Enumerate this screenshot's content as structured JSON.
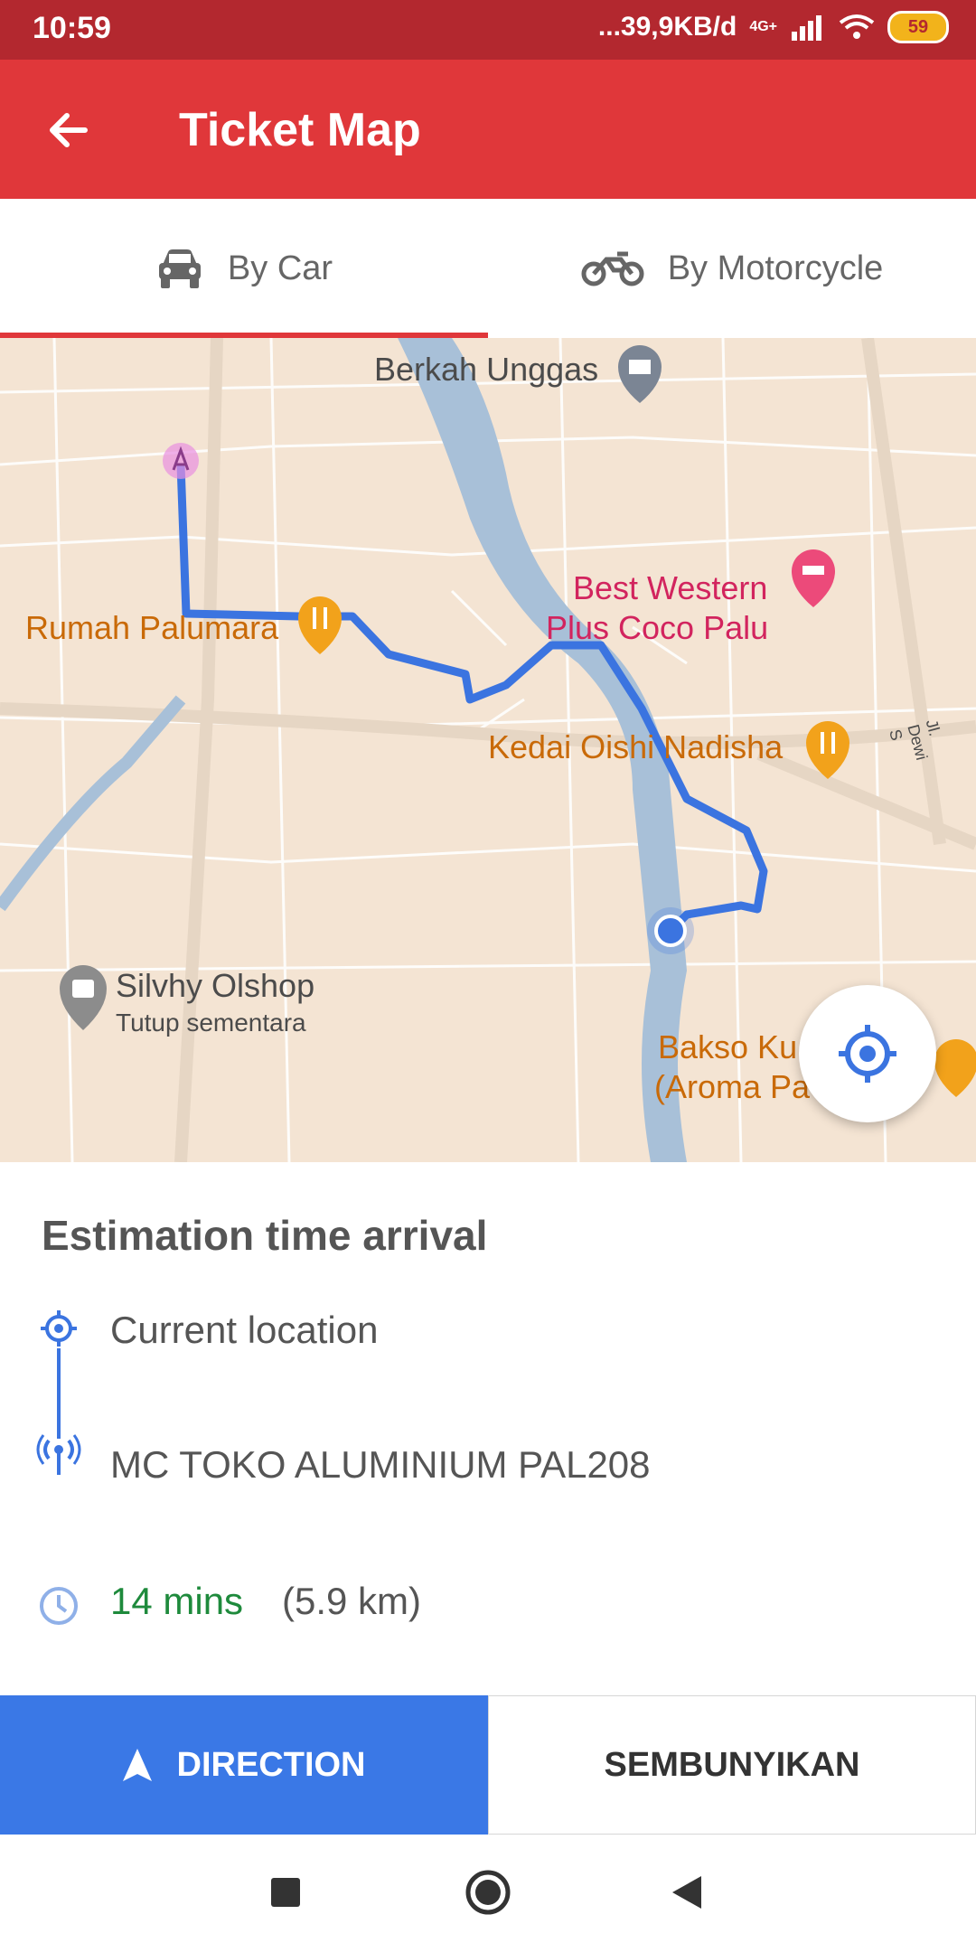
{
  "status_bar": {
    "time": "10:59",
    "speed": "...39,9KB/d",
    "network": "4G+",
    "battery": "59"
  },
  "app_bar": {
    "title": "Ticket Map",
    "back_icon": "arrow-left-icon"
  },
  "tabs": [
    {
      "label": "By Car",
      "icon": "car-icon",
      "selected": true
    },
    {
      "label": "By Motorcycle",
      "icon": "motorcycle-icon",
      "selected": false
    }
  ],
  "map": {
    "places": {
      "berkah": "Berkah Unggas",
      "rumah": "Rumah Palumara",
      "best_western_1": "Best Western",
      "best_western_2": "Plus Coco Palu",
      "kedai": "Kedai Oishi Nadisha",
      "silvhy": "Silvhy Olshop",
      "silvhy_status": "Tutup sementara",
      "bakso_1": "Bakso Ku",
      "bakso_2": "(Aroma Pa",
      "street": "Jl. Dewi S"
    }
  },
  "eta": {
    "heading": "Estimation time arrival",
    "origin": "Current location",
    "destination": "MC TOKO ALUMINIUM PAL208",
    "duration": "14 mins",
    "distance": "(5.9 km)"
  },
  "actions": {
    "direction": "DIRECTION",
    "hide": "SEMBUNYIKAN"
  },
  "colors": {
    "primary": "#e0373a",
    "route": "#3b74e0",
    "direction_button": "#3a78e6",
    "duration_text": "#1e8a3c"
  }
}
